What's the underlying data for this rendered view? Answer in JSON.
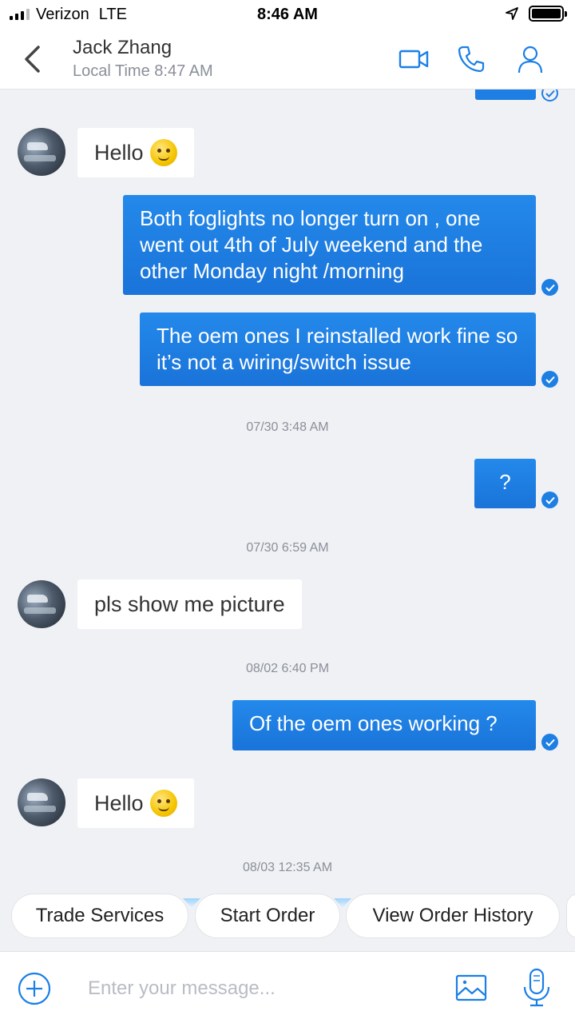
{
  "status_bar": {
    "carrier": "Verizon",
    "network": "LTE",
    "time": "8:46 AM"
  },
  "header": {
    "contact_name": "Jack Zhang",
    "local_time": "Local Time 8:47 AM",
    "icons": [
      "back-chevron-icon",
      "video-camera-icon",
      "phone-icon",
      "profile-icon"
    ]
  },
  "messages": [
    {
      "dir": "in",
      "text": "Hello",
      "emoji": true
    },
    {
      "dir": "out",
      "text": "Both foglights no longer turn on , one went out 4th of July weekend and the other Monday night /morning"
    },
    {
      "dir": "out",
      "text": "The oem ones I reinstalled work fine so it’s not a wiring/switch issue"
    },
    {
      "type": "timestamp",
      "text": "07/30 3:48 AM"
    },
    {
      "dir": "out",
      "text": "?"
    },
    {
      "type": "timestamp",
      "text": "07/30 6:59 AM"
    },
    {
      "dir": "in",
      "text": "pls show me picture"
    },
    {
      "type": "timestamp",
      "text": "08/02 6:40 PM"
    },
    {
      "dir": "out",
      "text": "Of the oem ones working ?"
    },
    {
      "dir": "in",
      "text": "Hello",
      "emoji": true
    },
    {
      "type": "timestamp",
      "text": "08/03 12:35 AM"
    }
  ],
  "quick_actions": [
    "Trade Services",
    "Start Order",
    "View Order History"
  ],
  "composer": {
    "placeholder": "Enter your message...",
    "icons": [
      "add-circle-icon",
      "image-icon",
      "microphone-icon"
    ]
  },
  "colors": {
    "accent": "#1a7fe6",
    "bubble_out": "#1e7ee4",
    "background": "#f0f1f5"
  }
}
